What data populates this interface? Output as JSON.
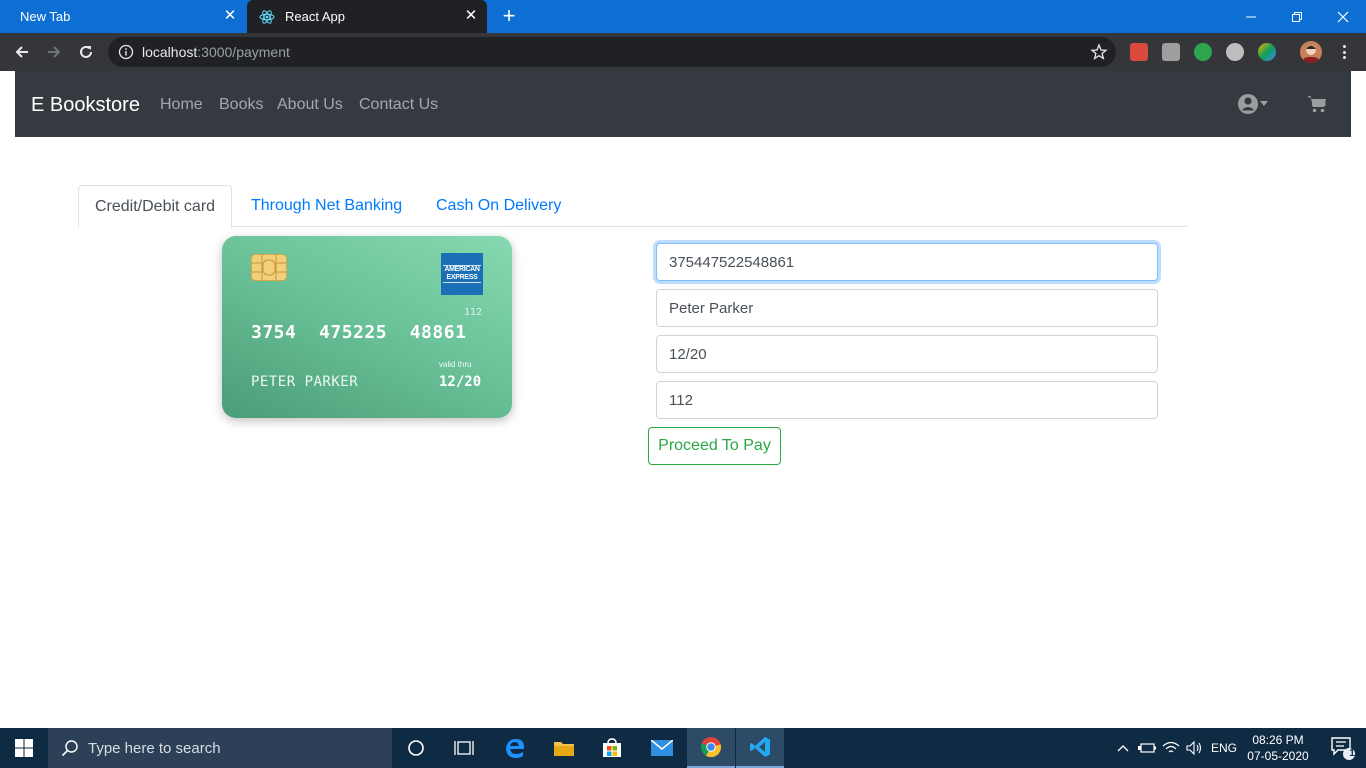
{
  "browser": {
    "tabs": [
      {
        "title": "New Tab",
        "active": false
      },
      {
        "title": "React App",
        "active": true
      }
    ],
    "url_host": "localhost",
    "url_path": ":3000/payment"
  },
  "navbar": {
    "brand": "E Bookstore",
    "links": [
      "Home",
      "Books",
      "About Us",
      "Contact Us"
    ]
  },
  "payment": {
    "tabs": [
      "Credit/Debit card",
      "Through Net Banking",
      "Cash On Delivery"
    ],
    "active_tab": "Credit/Debit card",
    "card": {
      "brand_text": "AMERICAN EXPRESS",
      "cvc": "112",
      "number": "3754  475225  48861",
      "valid_thru_label": "valid thru",
      "expiry": "12/20",
      "holder": "PETER PARKER"
    },
    "form": {
      "number_value": "375447522548861",
      "name_value": "Peter Parker",
      "expiry_value": "12/20",
      "cvc_value": "112"
    },
    "submit_label": "Proceed To Pay"
  },
  "taskbar": {
    "search_placeholder": "Type here to search",
    "language": "ENG",
    "time": "08:26 PM",
    "date": "07-05-2020",
    "notification_count": "1"
  },
  "colors": {
    "tabbar": "#0d6fd4",
    "navbar": "#343a40",
    "link": "#007bff",
    "success": "#28a745",
    "card_green": "#6cc399",
    "taskbar": "#0f2b44"
  }
}
